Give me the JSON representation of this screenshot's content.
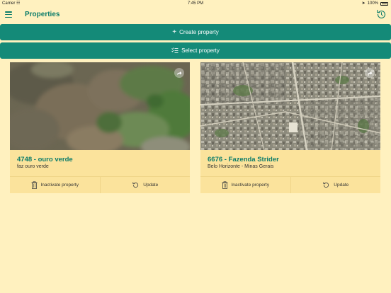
{
  "status": {
    "carrier": "Carrier",
    "time": "7:45 PM",
    "battery": "100%"
  },
  "nav": {
    "title": "Properties",
    "menu_icon": "hamburger-icon",
    "sync_icon": "sync-icon"
  },
  "actions": {
    "create_label": "Create property",
    "select_label": "Select property"
  },
  "properties": [
    {
      "title": "4748 - ouro verde",
      "subtitle": "faz ouro verde",
      "inactivate_label": "Inactivate property",
      "update_label": "Update"
    },
    {
      "title": "6676 - Fazenda Strider",
      "subtitle": "Belo Horizonte - Minas Gerais",
      "inactivate_label": "Inactivate property",
      "update_label": "Update"
    }
  ],
  "colors": {
    "accent": "#148a78",
    "title": "#0e7d6a",
    "background": "#fff1bf",
    "card": "#fbe39c"
  }
}
